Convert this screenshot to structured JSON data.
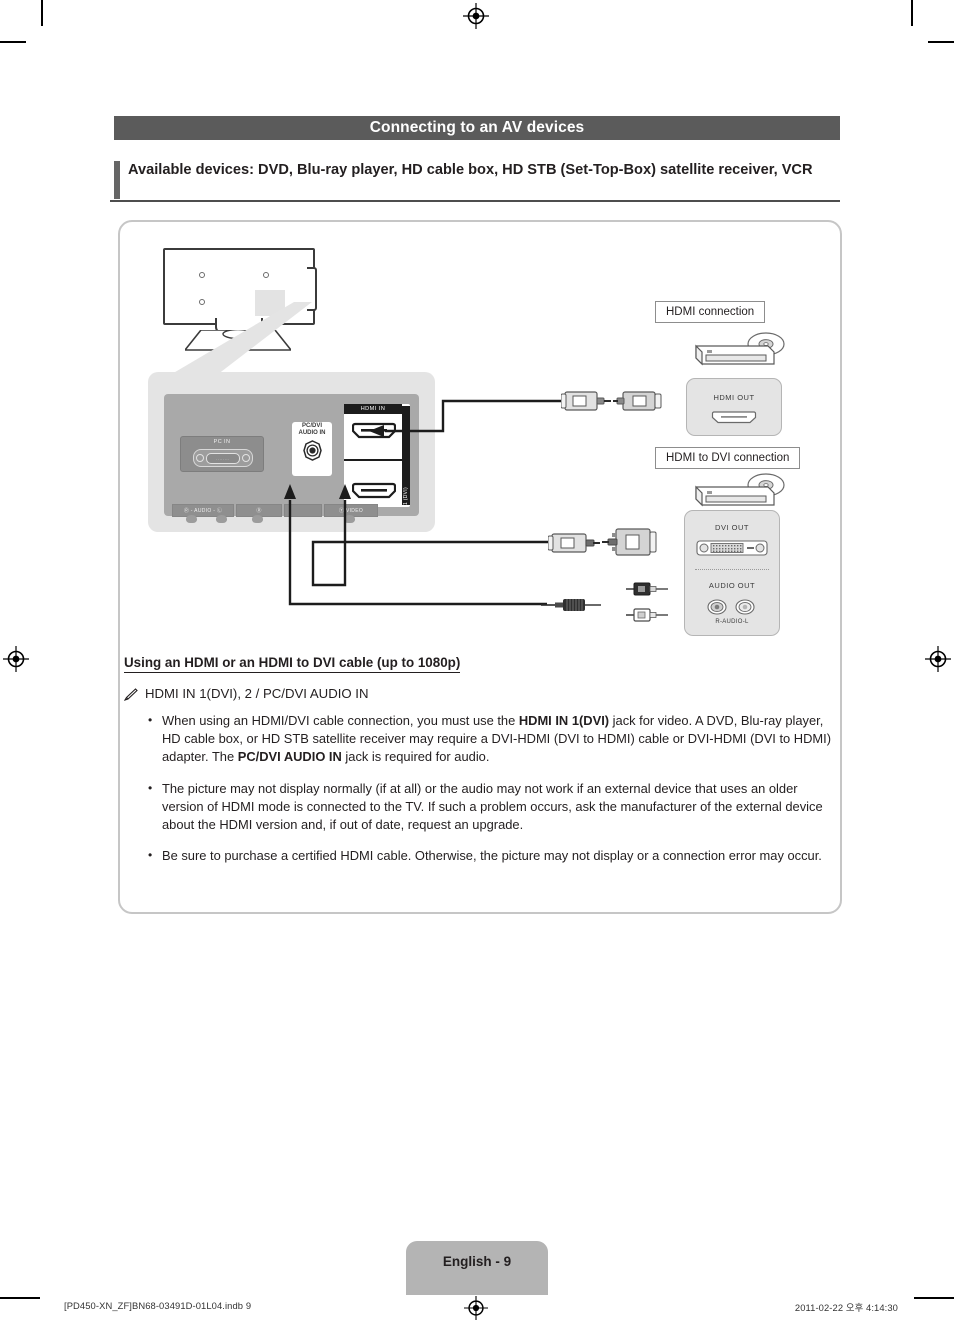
{
  "section": {
    "title": "Connecting to an AV devices",
    "available_devices": "Available devices: DVD, Blu-ray player, HD cable box, HD STB (Set-Top-Box) satellite receiver, VCR"
  },
  "diagram": {
    "tv_panel": {
      "pc_in_label": "PC IN",
      "pc_in_pins": "........",
      "audio_in_label_line1": "PC/DVI",
      "audio_in_label_line2": "AUDIO IN",
      "hdmi_in_label": "HDMI IN",
      "hdmi_side_label": "1 (DVI)",
      "bottom_row": [
        {
          "label": "Ⓡ - AUDIO - Ⓛ"
        },
        {
          "label": "Ⓡ"
        },
        {
          "label": ""
        },
        {
          "label": "Ⓨ/VIDEO"
        }
      ]
    },
    "connections": [
      {
        "label": "HDMI connection",
        "device_box": {
          "title": "HDMI OUT"
        }
      },
      {
        "label": "HDMI to DVI connection",
        "device_box": {
          "title": "DVI OUT",
          "audio_title": "AUDIO OUT",
          "audio_sub": "R-AUDIO-L"
        }
      }
    ]
  },
  "body": {
    "using_heading": "Using an HDMI or an HDMI to DVI cable (up to 1080p)",
    "note_heading": "HDMI IN 1(DVI), 2 / PC/DVI AUDIO IN",
    "bullets": [
      {
        "parts": [
          {
            "t": "When using an HDMI/DVI cable connection, you must use the ",
            "b": false
          },
          {
            "t": "HDMI IN 1(DVI)",
            "b": true
          },
          {
            "t": " jack for video. A DVD, Blu-ray player, HD cable box, or HD STB satellite receiver may require a DVI-HDMI (DVI to HDMI) cable or DVI-HDMI (DVI to HDMI) adapter. The ",
            "b": false
          },
          {
            "t": "PC/DVI AUDIO IN",
            "b": true
          },
          {
            "t": " jack is required for audio.",
            "b": false
          }
        ]
      },
      {
        "parts": [
          {
            "t": "The picture may not display normally (if at all) or the audio may not work if an external device that uses an older version of HDMI mode is connected to the TV. If such a problem occurs, ask the manufacturer of the external device about the HDMI version and, if out of date, request an upgrade.",
            "b": false
          }
        ]
      },
      {
        "parts": [
          {
            "t": "Be sure to purchase a certified HDMI cable. Otherwise, the picture may not display or a connection error may occur.",
            "b": false
          }
        ]
      }
    ]
  },
  "footer": {
    "page_badge": "English - 9",
    "file_ref": "[PD450-XN_ZF]BN68-03491D-01L04.indb   9",
    "timestamp": "2011-02-22   오후 4:14:30"
  },
  "colors": {
    "header_bar": "#5b5b5b",
    "panel_border": "#c6c6c6",
    "page_badge": "#b4b4b4",
    "jack_panel_outer": "#e4e4e4",
    "jack_panel_inner": "#a9a9a9"
  }
}
